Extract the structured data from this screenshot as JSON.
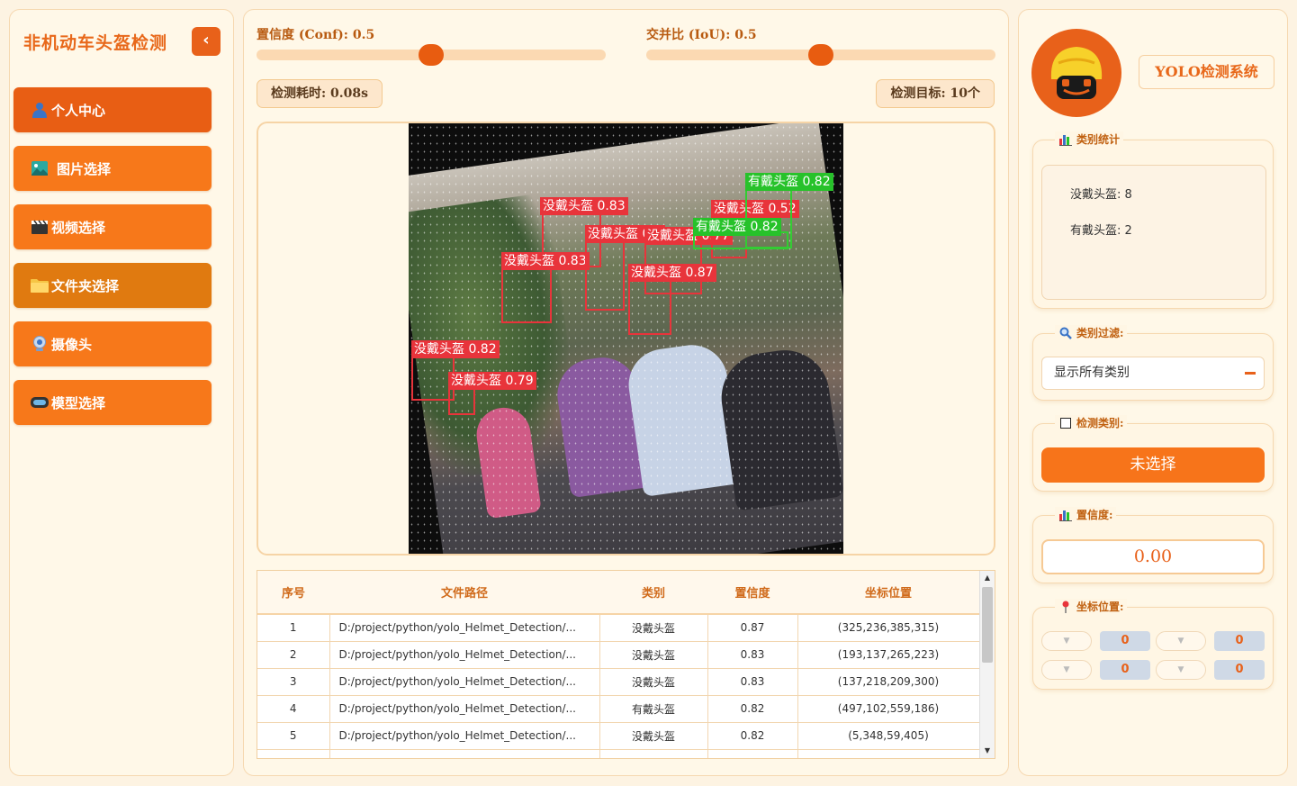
{
  "sidebar": {
    "title": "非机动车头盔检测",
    "collapse_glyph": "‹",
    "items": [
      {
        "label": "个人中心",
        "icon": "user-icon"
      },
      {
        "label": "图片选择",
        "icon": "image-icon"
      },
      {
        "label": "视频选择",
        "icon": "clapperboard-icon"
      },
      {
        "label": "文件夹选择",
        "icon": "folder-icon"
      },
      {
        "label": "摄像头",
        "icon": "camera-icon"
      },
      {
        "label": "模型选择",
        "icon": "vr-headset-icon"
      }
    ]
  },
  "controls": {
    "conf_label": "置信度 (Conf): 0.5",
    "conf_value": 0.5,
    "iou_label": "交并比 (IoU): 0.5",
    "iou_value": 0.5,
    "time_text": "检测耗时: 0.08s",
    "targets_text": "检测目标: 10个"
  },
  "detections_overlay": [
    {
      "label": "没戴头盔 0.83",
      "cls": "no-helmet"
    },
    {
      "label": "没戴头盔 0.83",
      "cls": "no-helmet"
    },
    {
      "label": "没戴头盔 0.8",
      "cls": "no-helmet"
    },
    {
      "label": "没戴头盔 0.77",
      "cls": "no-helmet"
    },
    {
      "label": "没戴头盔 0.87",
      "cls": "no-helmet"
    },
    {
      "label": "没戴头盔 0.82",
      "cls": "no-helmet"
    },
    {
      "label": "没戴头盔 0.79",
      "cls": "no-helmet"
    },
    {
      "label": "没戴头盔 0.52",
      "cls": "no-helmet"
    },
    {
      "label": "有戴头盔 0.82",
      "cls": "helmet"
    },
    {
      "label": "有戴头盔 0.82",
      "cls": "helmet"
    }
  ],
  "table": {
    "headers": [
      "序号",
      "文件路径",
      "类别",
      "置信度",
      "坐标位置"
    ],
    "rows": [
      [
        "1",
        "D:/project/python/yolo_Helmet_Detection/...",
        "没戴头盔",
        "0.87",
        "(325,236,385,315)"
      ],
      [
        "2",
        "D:/project/python/yolo_Helmet_Detection/...",
        "没戴头盔",
        "0.83",
        "(193,137,265,223)"
      ],
      [
        "3",
        "D:/project/python/yolo_Helmet_Detection/...",
        "没戴头盔",
        "0.83",
        "(137,218,209,300)"
      ],
      [
        "4",
        "D:/project/python/yolo_Helmet_Detection/...",
        "有戴头盔",
        "0.82",
        "(497,102,559,186)"
      ],
      [
        "5",
        "D:/project/python/yolo_Helmet_Detection/...",
        "没戴头盔",
        "0.82",
        "(5,348,59,405)"
      ]
    ]
  },
  "right": {
    "brand": "YOLO检测系统",
    "stats_title": "类别统计",
    "stats": [
      "没戴头盔: 8",
      "有戴头盔: 2"
    ],
    "filter_title": "类别过滤:",
    "filter_value": "显示所有类别",
    "detect_title": "检测类别:",
    "detect_button": "未选择",
    "conf_title": "置信度:",
    "conf_value": "0.00",
    "coord_title": "坐标位置:",
    "coords": {
      "xmin": "0",
      "ymin": "0",
      "xmax": "0",
      "ymax": "0"
    }
  },
  "colors": {
    "accent": "#f7781a",
    "accent_dark": "#e8611a",
    "no_helmet_box": "#e8343b",
    "helmet_box": "#27c22a",
    "panel_bg": "#fff8e8"
  }
}
